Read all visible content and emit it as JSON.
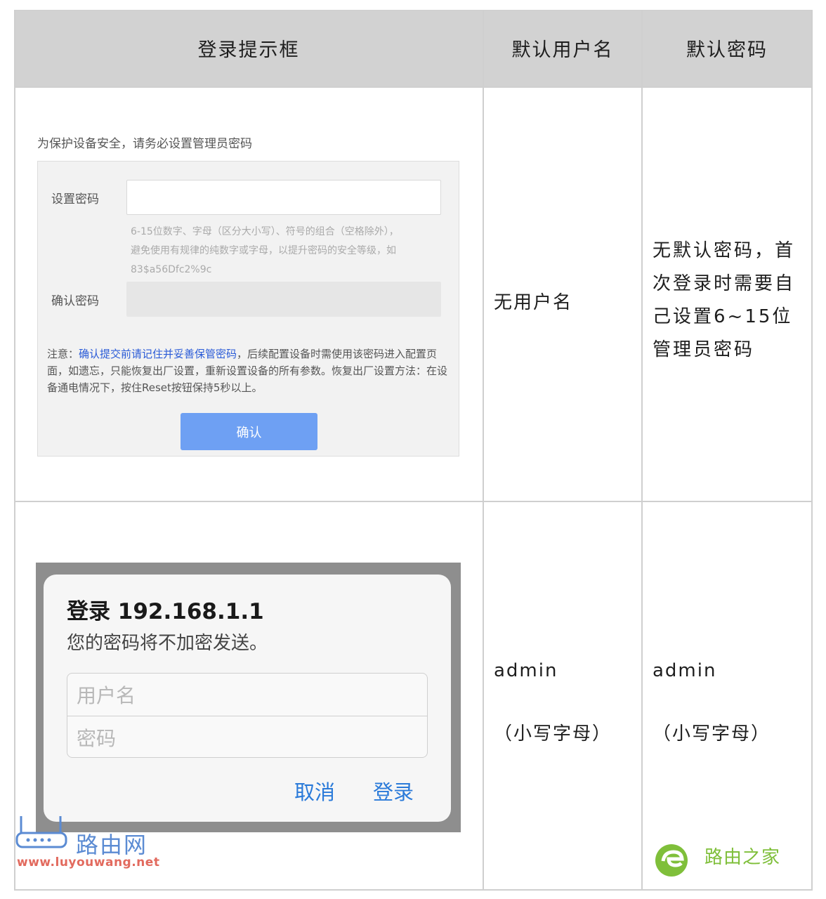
{
  "table": {
    "headers": [
      "登录提示框",
      "默认用户名",
      "默认密码"
    ],
    "rows": [
      {
        "username": "无用户名",
        "password_lines": [
          "无默认密码，首",
          "次登录时需要自",
          "己设置6~15位",
          "管理员密码"
        ]
      },
      {
        "username": "admin",
        "username_note": "（小写字母）",
        "password": "admin",
        "password_note": "（小写字母）"
      }
    ]
  },
  "setup_form": {
    "intro": "为保护设备安全，请务必设置管理员密码",
    "password_label": "设置密码",
    "password_value": "",
    "hint_lines": [
      "6-15位数字、字母（区分大小写）、符号的组合（空格除外），",
      "避免使用有规律的纯数字或字母，以提升密码的安全等级，如",
      "83$a56Dfc2%9c"
    ],
    "confirm_label": "确认密码",
    "confirm_value": "",
    "note_prefix": "注意：",
    "note_link": "确认提交前请记住并妥善保管密码",
    "note_rest": "，后续配置设备时需使用该密码进入配置页面，如遗忘，只能恢复出厂设置，重新设置设备的所有参数。恢复出厂设置方法：在设备通电情况下，按住Reset按钮保持5秒以上。",
    "confirm_button": "确认"
  },
  "auth_dialog": {
    "title": "登录 192.168.1.1",
    "subtitle": "您的密码将不加密发送。",
    "username_placeholder": "用户名",
    "password_placeholder": "密码",
    "cancel_button": "取消",
    "login_button": "登录"
  },
  "watermarks": {
    "left_name": "路由网",
    "left_url": "www.luyouwang.net",
    "right_name": "路由之家"
  },
  "colors": {
    "header_bg": "#d2d2d2",
    "link": "#2a5bd7",
    "confirm_button": "#6ea0f3",
    "dialog_button": "#2a7ad9"
  }
}
